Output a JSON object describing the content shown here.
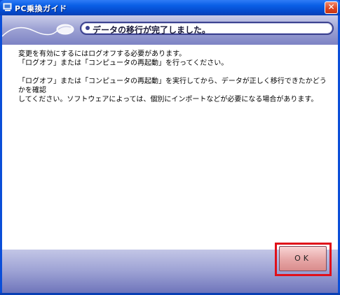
{
  "window": {
    "title": "PC乗換ガイド",
    "close_symbol": "✕"
  },
  "header": {
    "message": "データの移行が完了しました。"
  },
  "body": {
    "lines_1": [
      "変更を有効にするにはログオフする必要があります。",
      "「ログオフ」または「コンピュータの再起動」を行ってください。"
    ],
    "lines_2": [
      "「ログオフ」または「コンピュータの再起動」を実行してから、データが正しく移行できたかどうかを確認",
      "してください。ソフトウェアによっては、個別にインポートなどが必要になる場合があります。"
    ]
  },
  "footer": {
    "ok_label": "OK"
  },
  "icons": {
    "app": "computer-icon",
    "header": "mouse-icon"
  },
  "colors": {
    "titlebar": "#0a5fe6",
    "header_band": "#9ea3d4",
    "ok_button": "#e6a6a6",
    "highlight": "#e0101a"
  }
}
